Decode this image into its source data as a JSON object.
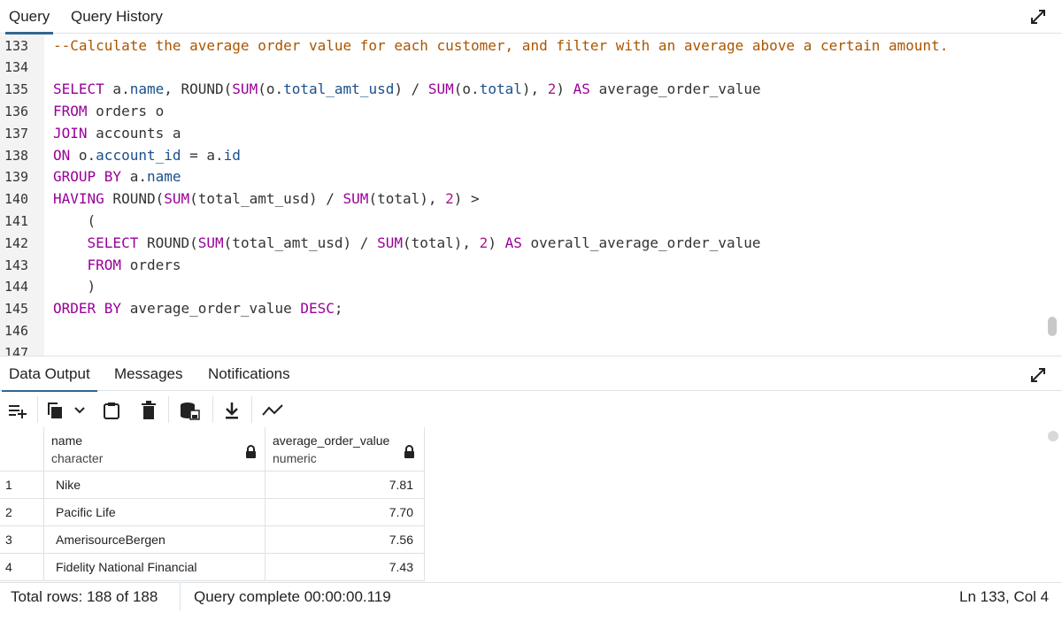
{
  "query_tabs": [
    "Query",
    "Query History"
  ],
  "editor": {
    "lines": [
      {
        "n": "133",
        "tokens": [
          {
            "t": "--Calculate the average order value for each customer, and filter with an average above a certain amount.",
            "c": "cm"
          }
        ]
      },
      {
        "n": "134",
        "tokens": []
      },
      {
        "n": "135",
        "tokens": [
          {
            "t": "SELECT",
            "c": "kw"
          },
          {
            "t": " a.",
            "c": "pl"
          },
          {
            "t": "name",
            "c": "id"
          },
          {
            "t": ", ",
            "c": "pl"
          },
          {
            "t": "ROUND(",
            "c": "pl"
          },
          {
            "t": "SUM",
            "c": "fn"
          },
          {
            "t": "(o.",
            "c": "pl"
          },
          {
            "t": "total_amt_usd",
            "c": "id"
          },
          {
            "t": ") / ",
            "c": "pl"
          },
          {
            "t": "SUM",
            "c": "fn"
          },
          {
            "t": "(o.",
            "c": "pl"
          },
          {
            "t": "total",
            "c": "id"
          },
          {
            "t": "), ",
            "c": "pl"
          },
          {
            "t": "2",
            "c": "num"
          },
          {
            "t": ") ",
            "c": "pl"
          },
          {
            "t": "AS",
            "c": "kw"
          },
          {
            "t": " average_order_value",
            "c": "pl"
          }
        ]
      },
      {
        "n": "136",
        "tokens": [
          {
            "t": "FROM",
            "c": "kw"
          },
          {
            "t": " orders o",
            "c": "pl"
          }
        ]
      },
      {
        "n": "137",
        "tokens": [
          {
            "t": "JOIN",
            "c": "kw"
          },
          {
            "t": " accounts a",
            "c": "pl"
          }
        ]
      },
      {
        "n": "138",
        "tokens": [
          {
            "t": "ON",
            "c": "kw"
          },
          {
            "t": " o.",
            "c": "pl"
          },
          {
            "t": "account_id",
            "c": "id"
          },
          {
            "t": " = a.",
            "c": "pl"
          },
          {
            "t": "id",
            "c": "id"
          }
        ]
      },
      {
        "n": "139",
        "tokens": [
          {
            "t": "GROUP BY",
            "c": "kw"
          },
          {
            "t": " a.",
            "c": "pl"
          },
          {
            "t": "name",
            "c": "id"
          }
        ]
      },
      {
        "n": "140",
        "tokens": [
          {
            "t": "HAVING",
            "c": "kw"
          },
          {
            "t": " ROUND(",
            "c": "pl"
          },
          {
            "t": "SUM",
            "c": "fn"
          },
          {
            "t": "(total_amt_usd) / ",
            "c": "pl"
          },
          {
            "t": "SUM",
            "c": "fn"
          },
          {
            "t": "(total), ",
            "c": "pl"
          },
          {
            "t": "2",
            "c": "num"
          },
          {
            "t": ") >",
            "c": "pl"
          }
        ]
      },
      {
        "n": "141",
        "tokens": [
          {
            "t": "    (",
            "c": "pl"
          }
        ]
      },
      {
        "n": "142",
        "tokens": [
          {
            "t": "    ",
            "c": "pl"
          },
          {
            "t": "SELECT",
            "c": "kw"
          },
          {
            "t": " ROUND(",
            "c": "pl"
          },
          {
            "t": "SUM",
            "c": "fn"
          },
          {
            "t": "(total_amt_usd) / ",
            "c": "pl"
          },
          {
            "t": "SUM",
            "c": "fn"
          },
          {
            "t": "(total), ",
            "c": "pl"
          },
          {
            "t": "2",
            "c": "num"
          },
          {
            "t": ") ",
            "c": "pl"
          },
          {
            "t": "AS",
            "c": "kw"
          },
          {
            "t": " overall_average_order_value",
            "c": "pl"
          }
        ]
      },
      {
        "n": "143",
        "tokens": [
          {
            "t": "    ",
            "c": "pl"
          },
          {
            "t": "FROM",
            "c": "kw"
          },
          {
            "t": " orders",
            "c": "pl"
          }
        ]
      },
      {
        "n": "144",
        "tokens": [
          {
            "t": "    )",
            "c": "pl"
          }
        ]
      },
      {
        "n": "145",
        "tokens": [
          {
            "t": "ORDER BY",
            "c": "kw"
          },
          {
            "t": " average_order_value ",
            "c": "pl"
          },
          {
            "t": "DESC",
            "c": "kw"
          },
          {
            "t": ";",
            "c": "pl"
          }
        ]
      },
      {
        "n": "146",
        "tokens": []
      },
      {
        "n": "147",
        "tokens": []
      }
    ]
  },
  "output_tabs": [
    "Data Output",
    "Messages",
    "Notifications"
  ],
  "grid": {
    "columns": [
      {
        "name": "name",
        "type": "character"
      },
      {
        "name": "average_order_value",
        "type": "numeric"
      }
    ],
    "rows": [
      {
        "n": "1",
        "name": "Nike",
        "value": "7.81"
      },
      {
        "n": "2",
        "name": "Pacific Life",
        "value": "7.70"
      },
      {
        "n": "3",
        "name": "AmerisourceBergen",
        "value": "7.56"
      },
      {
        "n": "4",
        "name": "Fidelity National Financial",
        "value": "7.43"
      }
    ]
  },
  "status": {
    "total_rows": "Total rows: 188 of 188",
    "query_time": "Query complete 00:00:00.119",
    "cursor": "Ln 133, Col 4"
  },
  "colors": {
    "accent": "#326690",
    "keyword": "#990099",
    "identifier": "#1a4f8c",
    "comment": "#aa5500"
  }
}
